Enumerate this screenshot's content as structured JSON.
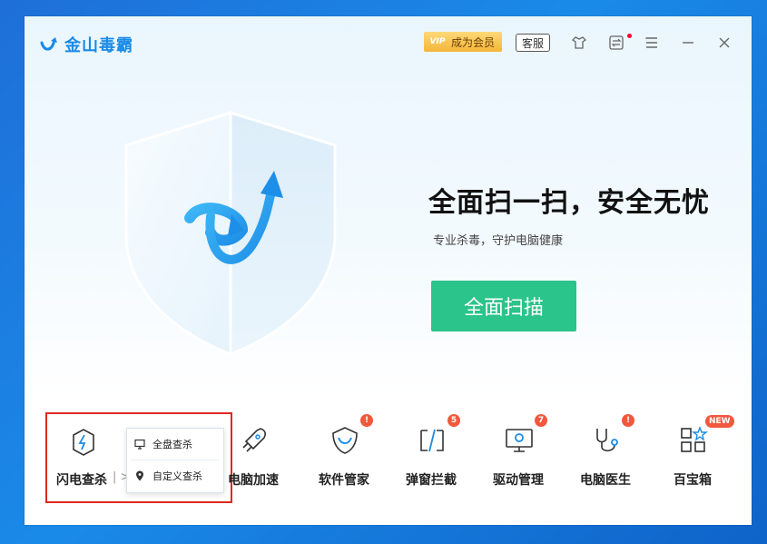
{
  "app": {
    "name": "金山毒霸"
  },
  "titlebar": {
    "vip_badge": "VIP",
    "vip_label": "成为会员",
    "support_label": "客服",
    "icons": [
      "clothes-skin-icon",
      "swap-icon",
      "menu-icon",
      "minimize-icon",
      "close-icon"
    ]
  },
  "hero": {
    "headline": "全面扫一扫，安全无忧",
    "subline": "专业杀毒，守护电脑健康",
    "scan_button": "全面扫描"
  },
  "tools": {
    "flash": {
      "label": "闪电查杀",
      "separator": "|",
      "arrow": ">"
    },
    "speedup": {
      "label": "电脑加速"
    },
    "software": {
      "label": "软件管家",
      "badge": "!"
    },
    "popup": {
      "label": "弹窗拦截",
      "badge": "5"
    },
    "driver": {
      "label": "驱动管理",
      "badge": "7"
    },
    "doctor": {
      "label": "电脑医生",
      "badge": "!"
    },
    "toolbox": {
      "label": "百宝箱",
      "badge": "NEW"
    }
  },
  "dropdown": {
    "items": [
      {
        "label": "全盘查杀",
        "icon": "monitor-icon"
      },
      {
        "label": "自定义查杀",
        "icon": "location-pin-icon"
      }
    ]
  },
  "colors": {
    "brand_blue": "#1a8be6",
    "scan_green": "#2bc48a",
    "badge_red": "#f2583e",
    "highlight_red": "#e0281f"
  }
}
